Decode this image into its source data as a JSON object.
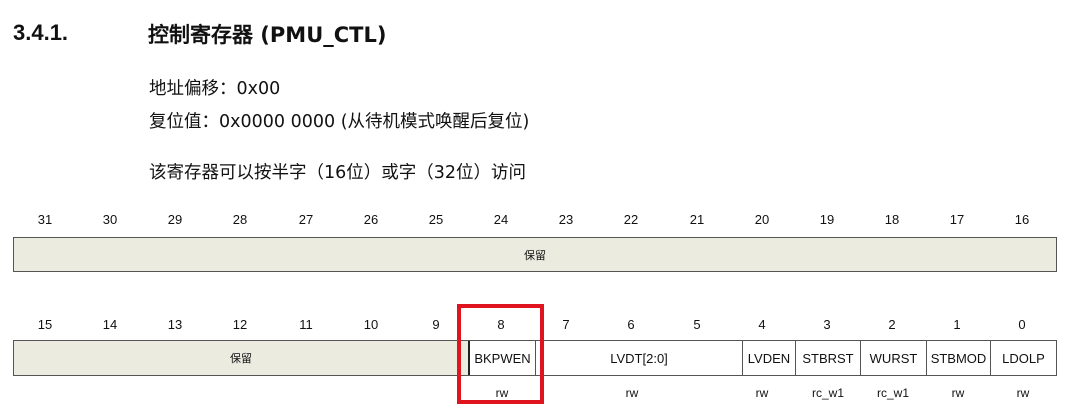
{
  "section": {
    "number": "3.4.1.",
    "title": "控制寄存器 (PMU_CTL)"
  },
  "info": {
    "offset": "地址偏移：0x00",
    "reset": "复位值：0x0000 0000 (从待机模式唤醒后复位)",
    "access_note": "该寄存器可以按半字（16位）或字（32位）访问"
  },
  "upper_row": {
    "bits": [
      "31",
      "30",
      "29",
      "28",
      "27",
      "26",
      "25",
      "24",
      "23",
      "22",
      "21",
      "20",
      "19",
      "18",
      "17",
      "16"
    ],
    "fields": [
      {
        "name": "保留",
        "access": ""
      }
    ]
  },
  "lower_row": {
    "bits": [
      "15",
      "14",
      "13",
      "12",
      "11",
      "10",
      "9",
      "8",
      "7",
      "6",
      "5",
      "4",
      "3",
      "2",
      "1",
      "0"
    ],
    "fields": [
      {
        "name": "保留",
        "access": ""
      },
      {
        "name": "BKPWEN",
        "access": "rw"
      },
      {
        "name": "LVDT[2:0]",
        "access": "rw"
      },
      {
        "name": "LVDEN",
        "access": "rw"
      },
      {
        "name": "STBRST",
        "access": "rc_w1"
      },
      {
        "name": "WURST",
        "access": "rc_w1"
      },
      {
        "name": "STBMOD",
        "access": "rw"
      },
      {
        "name": "LDOLP",
        "access": "rw"
      }
    ]
  },
  "colors": {
    "reserved_fill": "#ecebe0",
    "highlight_border": "#e0141e"
  }
}
